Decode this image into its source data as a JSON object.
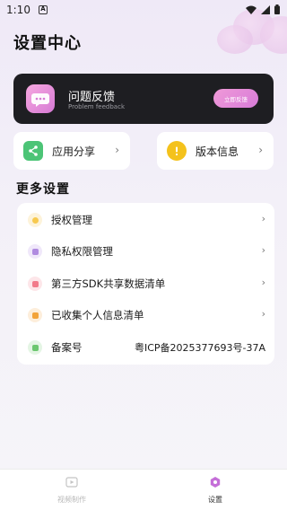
{
  "status_bar": {
    "time": "1:10",
    "notification": "A"
  },
  "page_title": "设置中心",
  "feedback": {
    "title": "问题反馈",
    "subtitle": "Problem feedback",
    "button": "立即反馈"
  },
  "quick": [
    {
      "label": "应用分享",
      "icon": "share-icon",
      "color": "#4cc476"
    },
    {
      "label": "版本信息",
      "icon": "info-icon",
      "color": "#f4c21c"
    }
  ],
  "section_title": "更多设置",
  "settings": [
    {
      "label": "授权管理",
      "icon": "authorization-icon",
      "color": "#f7c94f",
      "bg": "#fdf3da",
      "arrow": "›"
    },
    {
      "label": "隐私权限管理",
      "icon": "privacy-icon",
      "color": "#b08be0",
      "bg": "#f0e8fa",
      "arrow": "›"
    },
    {
      "label": "第三方SDK共享数据清单",
      "icon": "sdk-list-icon",
      "color": "#f27a8a",
      "bg": "#fde6e9",
      "arrow": "›"
    },
    {
      "label": "已收集个人信息清单",
      "icon": "collected-info-icon",
      "color": "#f2a33a",
      "bg": "#fdeedb",
      "arrow": "›"
    },
    {
      "label": "备案号",
      "icon": "record-icon",
      "color": "#6cc76f",
      "bg": "#e4f5e4",
      "value": "粤ICP备2025377693号-37A"
    }
  ],
  "nav": [
    {
      "label": "视频制作",
      "icon": "video-icon",
      "active": false
    },
    {
      "label": "设置",
      "icon": "settings-icon",
      "active": true
    }
  ],
  "colors": {
    "accent": "#d77bd8",
    "active_nav": "#c56fd8",
    "inactive_nav": "#b8b8b8"
  }
}
